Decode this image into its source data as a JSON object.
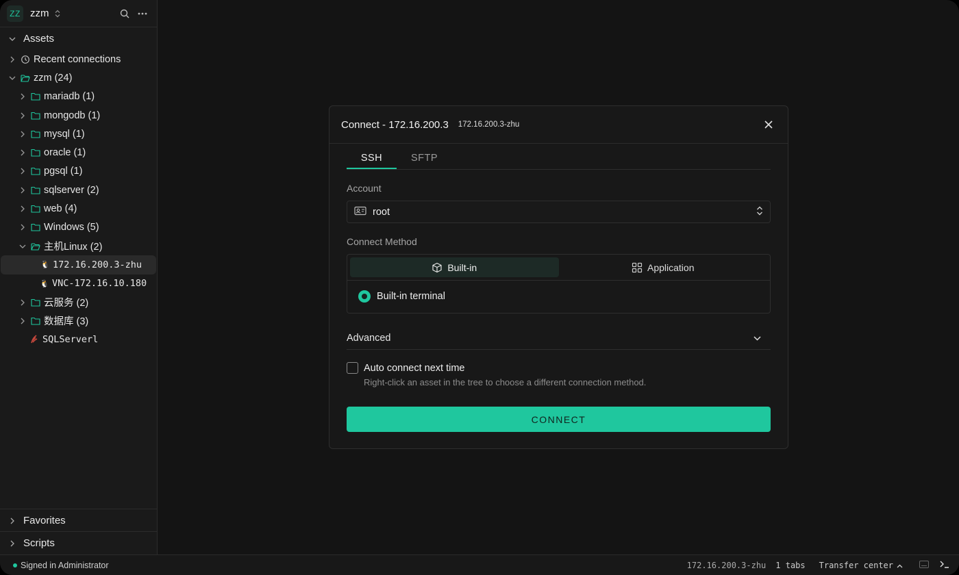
{
  "workspace": {
    "avatar": "ZZ",
    "name": "zzm"
  },
  "assets": {
    "title": "Assets",
    "recent": "Recent connections",
    "root": "zzm (24)",
    "folders": [
      "mariadb (1)",
      "mongodb (1)",
      "mysql (1)",
      "oracle (1)",
      "pgsql (1)",
      "sqlserver (2)",
      "web (4)",
      "Windows (5)",
      "主机Linux (2)"
    ],
    "linux_hosts": [
      "172.16.200.3-zhu",
      "VNC-172.16.10.180"
    ],
    "folders_after": [
      "云服务 (2)",
      "数据库 (3)"
    ],
    "sqlserver_item": "SQLServerl"
  },
  "favorites": "Favorites",
  "scripts": "Scripts",
  "status": {
    "signed_in": "Signed in Administrator",
    "host": "172.16.200.3-zhu",
    "tabs": "1 tabs",
    "transfer": "Transfer center"
  },
  "modal": {
    "title": "Connect - 172.16.200.3",
    "subtitle": "172.16.200.3-zhu",
    "tabs": [
      "SSH",
      "SFTP"
    ],
    "account_label": "Account",
    "account_value": "root",
    "method_label": "Connect Method",
    "method_builtin": "Built-in",
    "method_application": "Application",
    "builtin_terminal": "Built-in terminal",
    "advanced": "Advanced",
    "auto_connect": "Auto connect next time",
    "hint": "Right-click an asset in the tree to choose a different connection method.",
    "connect_button": "CONNECT"
  },
  "colors": {
    "accent": "#1fc79e",
    "background": "#141414",
    "sidebar": "#1a1a1a"
  }
}
